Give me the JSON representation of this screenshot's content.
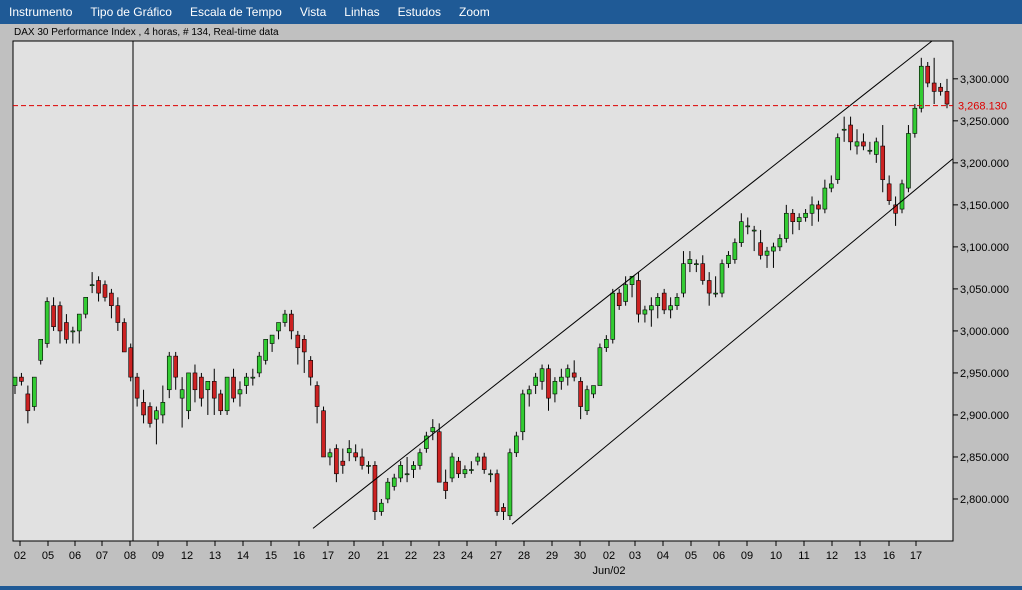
{
  "menu": {
    "items": [
      "Instrumento",
      "Tipo de Gráfico",
      "Escala de Tempo",
      "Vista",
      "Linhas",
      "Estudos",
      "Zoom"
    ]
  },
  "colors": {
    "menubar": "#1f5a96",
    "plot_background": "#e1e1e1",
    "up_candle": "#33cc33",
    "down_candle": "#cc2222",
    "reference_line": "#dd0000"
  },
  "chart_data": {
    "type": "candlestick",
    "title": "DAX 30 Performance Index , 4 horas, # 134, Real-time data",
    "xlabel": "Jun/02",
    "ylim": [
      2750,
      3345
    ],
    "yticks": [
      "2,800.000",
      "2,850.000",
      "2,900.000",
      "2,950.000",
      "3,000.000",
      "3,050.000",
      "3,100.000",
      "3,150.000",
      "3,200.000",
      "3,250.000",
      "3,300.000"
    ],
    "ytick_values": [
      2800,
      2850,
      2900,
      2950,
      3000,
      3050,
      3100,
      3150,
      3200,
      3250,
      3300
    ],
    "xticks": [
      "02",
      "05",
      "06",
      "07",
      "08",
      "09",
      "12",
      "13",
      "14",
      "15",
      "16",
      "17",
      "20",
      "21",
      "22",
      "23",
      "24",
      "27",
      "28",
      "29",
      "30",
      "02",
      "03",
      "04",
      "05",
      "06",
      "09",
      "10",
      "11",
      "12",
      "13",
      "16",
      "17"
    ],
    "reference_value": 3268.13,
    "reference_label": "3,268.130",
    "candles": [
      [
        2935,
        2945,
        2925,
        2945
      ],
      [
        2945,
        2950,
        2935,
        2940
      ],
      [
        2925,
        2935,
        2890,
        2905
      ],
      [
        2910,
        2945,
        2905,
        2945
      ],
      [
        2965,
        2990,
        2960,
        2990
      ],
      [
        2985,
        3040,
        2980,
        3035
      ],
      [
        3030,
        3040,
        3000,
        3005
      ],
      [
        3030,
        3035,
        2985,
        3000
      ],
      [
        3010,
        3020,
        2985,
        2990
      ],
      [
        3000,
        3005,
        2985,
        3000
      ],
      [
        3000,
        3020,
        2985,
        3020
      ],
      [
        3020,
        3040,
        3015,
        3040
      ],
      [
        3055,
        3070,
        3045,
        3055
      ],
      [
        3060,
        3065,
        3035,
        3045
      ],
      [
        3055,
        3060,
        3035,
        3040
      ],
      [
        3045,
        3050,
        3015,
        3030
      ],
      [
        3030,
        3040,
        3000,
        3010
      ],
      [
        3010,
        3015,
        2980,
        2975
      ],
      [
        2980,
        2985,
        2940,
        2945
      ],
      [
        2945,
        2950,
        2910,
        2920
      ],
      [
        2915,
        2930,
        2890,
        2900
      ],
      [
        2910,
        2915,
        2885,
        2890
      ],
      [
        2895,
        2910,
        2865,
        2905
      ],
      [
        2900,
        2935,
        2890,
        2915
      ],
      [
        2930,
        2975,
        2920,
        2970
      ],
      [
        2970,
        2975,
        2930,
        2945
      ],
      [
        2920,
        2945,
        2885,
        2930
      ],
      [
        2905,
        2950,
        2895,
        2950
      ],
      [
        2950,
        2960,
        2915,
        2930
      ],
      [
        2945,
        2950,
        2910,
        2920
      ],
      [
        2930,
        2940,
        2900,
        2940
      ],
      [
        2940,
        2955,
        2900,
        2920
      ],
      [
        2925,
        2930,
        2900,
        2905
      ],
      [
        2905,
        2945,
        2900,
        2945
      ],
      [
        2945,
        2955,
        2915,
        2920
      ],
      [
        2925,
        2940,
        2910,
        2930
      ],
      [
        2935,
        2950,
        2925,
        2945
      ],
      [
        2945,
        2955,
        2935,
        2945
      ],
      [
        2950,
        2975,
        2945,
        2970
      ],
      [
        2965,
        2990,
        2960,
        2990
      ],
      [
        2985,
        2995,
        2975,
        2995
      ],
      [
        3000,
        3010,
        2990,
        3010
      ],
      [
        3010,
        3025,
        3005,
        3020
      ],
      [
        3020,
        3025,
        2990,
        3000
      ],
      [
        2995,
        3000,
        2960,
        2980
      ],
      [
        2990,
        2995,
        2950,
        2975
      ],
      [
        2965,
        2970,
        2935,
        2945
      ],
      [
        2935,
        2940,
        2890,
        2910
      ],
      [
        2905,
        2910,
        2850,
        2850
      ],
      [
        2850,
        2860,
        2840,
        2855
      ],
      [
        2860,
        2865,
        2820,
        2830
      ],
      [
        2845,
        2860,
        2830,
        2840
      ],
      [
        2855,
        2870,
        2845,
        2860
      ],
      [
        2855,
        2865,
        2845,
        2850
      ],
      [
        2850,
        2860,
        2835,
        2840
      ],
      [
        2840,
        2845,
        2830,
        2840
      ],
      [
        2840,
        2845,
        2775,
        2785
      ],
      [
        2785,
        2800,
        2780,
        2795
      ],
      [
        2800,
        2825,
        2795,
        2820
      ],
      [
        2815,
        2830,
        2810,
        2825
      ],
      [
        2825,
        2845,
        2820,
        2840
      ],
      [
        2830,
        2850,
        2820,
        2830
      ],
      [
        2835,
        2845,
        2825,
        2840
      ],
      [
        2840,
        2860,
        2835,
        2855
      ],
      [
        2860,
        2880,
        2855,
        2875
      ],
      [
        2880,
        2895,
        2870,
        2885
      ],
      [
        2880,
        2890,
        2820,
        2820
      ],
      [
        2820,
        2835,
        2800,
        2810
      ],
      [
        2825,
        2855,
        2820,
        2850
      ],
      [
        2845,
        2850,
        2825,
        2830
      ],
      [
        2830,
        2840,
        2825,
        2835
      ],
      [
        2835,
        2845,
        2830,
        2835
      ],
      [
        2845,
        2855,
        2840,
        2850
      ],
      [
        2850,
        2855,
        2830,
        2835
      ],
      [
        2830,
        2835,
        2820,
        2830
      ],
      [
        2830,
        2835,
        2780,
        2785
      ],
      [
        2790,
        2795,
        2775,
        2785
      ],
      [
        2780,
        2860,
        2775,
        2855
      ],
      [
        2855,
        2880,
        2850,
        2875
      ],
      [
        2880,
        2930,
        2870,
        2925
      ],
      [
        2925,
        2935,
        2910,
        2930
      ],
      [
        2935,
        2950,
        2925,
        2945
      ],
      [
        2940,
        2960,
        2930,
        2955
      ],
      [
        2955,
        2960,
        2905,
        2920
      ],
      [
        2925,
        2945,
        2915,
        2940
      ],
      [
        2940,
        2955,
        2930,
        2945
      ],
      [
        2945,
        2960,
        2935,
        2955
      ],
      [
        2950,
        2965,
        2940,
        2945
      ],
      [
        2940,
        2945,
        2895,
        2910
      ],
      [
        2905,
        2935,
        2900,
        2930
      ],
      [
        2925,
        2935,
        2920,
        2935
      ],
      [
        2935,
        2985,
        2935,
        2980
      ],
      [
        2980,
        2995,
        2975,
        2990
      ],
      [
        2990,
        3050,
        2985,
        3045
      ],
      [
        3045,
        3050,
        3025,
        3030
      ],
      [
        3035,
        3065,
        3030,
        3055
      ],
      [
        3055,
        3065,
        3040,
        3065
      ],
      [
        3060,
        3070,
        3010,
        3020
      ],
      [
        3020,
        3030,
        3010,
        3025
      ],
      [
        3025,
        3040,
        3005,
        3030
      ],
      [
        3030,
        3045,
        3015,
        3040
      ],
      [
        3045,
        3050,
        3020,
        3025
      ],
      [
        3025,
        3040,
        3015,
        3030
      ],
      [
        3030,
        3045,
        3025,
        3040
      ],
      [
        3045,
        3095,
        3040,
        3080
      ],
      [
        3080,
        3095,
        3070,
        3085
      ],
      [
        3080,
        3085,
        3070,
        3080
      ],
      [
        3080,
        3090,
        3055,
        3060
      ],
      [
        3060,
        3070,
        3030,
        3045
      ],
      [
        3045,
        3065,
        3040,
        3045
      ],
      [
        3045,
        3085,
        3040,
        3080
      ],
      [
        3080,
        3095,
        3075,
        3090
      ],
      [
        3085,
        3110,
        3080,
        3105
      ],
      [
        3105,
        3140,
        3100,
        3130
      ],
      [
        3125,
        3135,
        3115,
        3125
      ],
      [
        3120,
        3125,
        3095,
        3120
      ],
      [
        3105,
        3120,
        3085,
        3090
      ],
      [
        3090,
        3100,
        3075,
        3095
      ],
      [
        3095,
        3105,
        3075,
        3100
      ],
      [
        3100,
        3115,
        3095,
        3110
      ],
      [
        3110,
        3150,
        3105,
        3140
      ],
      [
        3140,
        3145,
        3115,
        3130
      ],
      [
        3130,
        3140,
        3120,
        3135
      ],
      [
        3135,
        3145,
        3130,
        3140
      ],
      [
        3140,
        3160,
        3125,
        3150
      ],
      [
        3150,
        3155,
        3130,
        3145
      ],
      [
        3145,
        3180,
        3140,
        3170
      ],
      [
        3170,
        3185,
        3165,
        3175
      ],
      [
        3180,
        3235,
        3175,
        3230
      ],
      [
        3240,
        3255,
        3225,
        3240
      ],
      [
        3245,
        3255,
        3215,
        3225
      ],
      [
        3220,
        3240,
        3210,
        3225
      ],
      [
        3225,
        3235,
        3215,
        3220
      ],
      [
        3215,
        3225,
        3210,
        3215
      ],
      [
        3210,
        3230,
        3200,
        3225
      ],
      [
        3220,
        3245,
        3165,
        3180
      ],
      [
        3175,
        3185,
        3150,
        3155
      ],
      [
        3150,
        3160,
        3125,
        3140
      ],
      [
        3145,
        3180,
        3140,
        3175
      ],
      [
        3170,
        3245,
        3165,
        3235
      ],
      [
        3235,
        3270,
        3230,
        3265
      ],
      [
        3265,
        3325,
        3260,
        3315
      ],
      [
        3315,
        3320,
        3290,
        3295
      ],
      [
        3295,
        3325,
        3270,
        3285
      ],
      [
        3290,
        3295,
        3280,
        3285
      ],
      [
        3285,
        3300,
        3265,
        3270
      ]
    ],
    "trend_lines": [
      {
        "from": [
          0.0,
          2775
        ],
        "to": [
          1.0,
          3350
        ],
        "segment": "upper-channel"
      },
      {
        "from": [
          0.0,
          2775
        ],
        "to": [
          1.0,
          3205
        ],
        "segment": "lower-channel"
      }
    ]
  }
}
